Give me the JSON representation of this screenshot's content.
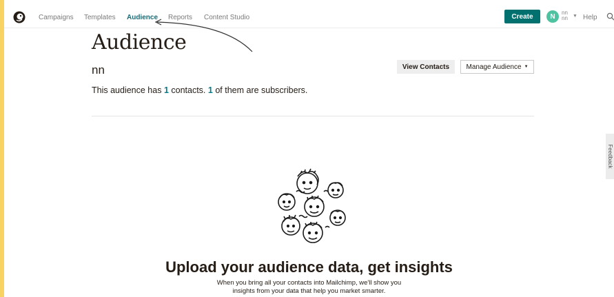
{
  "nav": {
    "items": [
      {
        "label": "Campaigns",
        "active": false
      },
      {
        "label": "Templates",
        "active": false
      },
      {
        "label": "Audience",
        "active": true
      },
      {
        "label": "Reports",
        "active": false
      },
      {
        "label": "Content Studio",
        "active": false
      }
    ],
    "create_label": "Create",
    "avatar_initial": "N",
    "user_name_line1": "nn",
    "user_name_line2": "nn",
    "help_label": "Help"
  },
  "header": {
    "title": "Audience",
    "audience_name": "nn",
    "view_contacts_label": "View Contacts",
    "manage_audience_label": "Manage Audience"
  },
  "summary": {
    "prefix": "This audience has",
    "contacts_count": "1",
    "middle": "contacts.",
    "subscribers_count": "1",
    "suffix": "of them are subscribers."
  },
  "insights": {
    "title": "Upload your audience data, get insights",
    "body_line1": "When you bring all your contacts into Mailchimp, we'll show you",
    "body_line2": "insights from your data that help you market smarter."
  },
  "feedback_label": "Feedback",
  "colors": {
    "frame": "#f9d362",
    "accent": "#007c89",
    "create_button": "#00716f",
    "avatar": "#4fc3a1"
  },
  "icons": [
    "mailchimp-logo-icon",
    "search-icon",
    "chevron-down-icon",
    "annotation-arrow-icon",
    "audience-faces-illustration"
  ]
}
